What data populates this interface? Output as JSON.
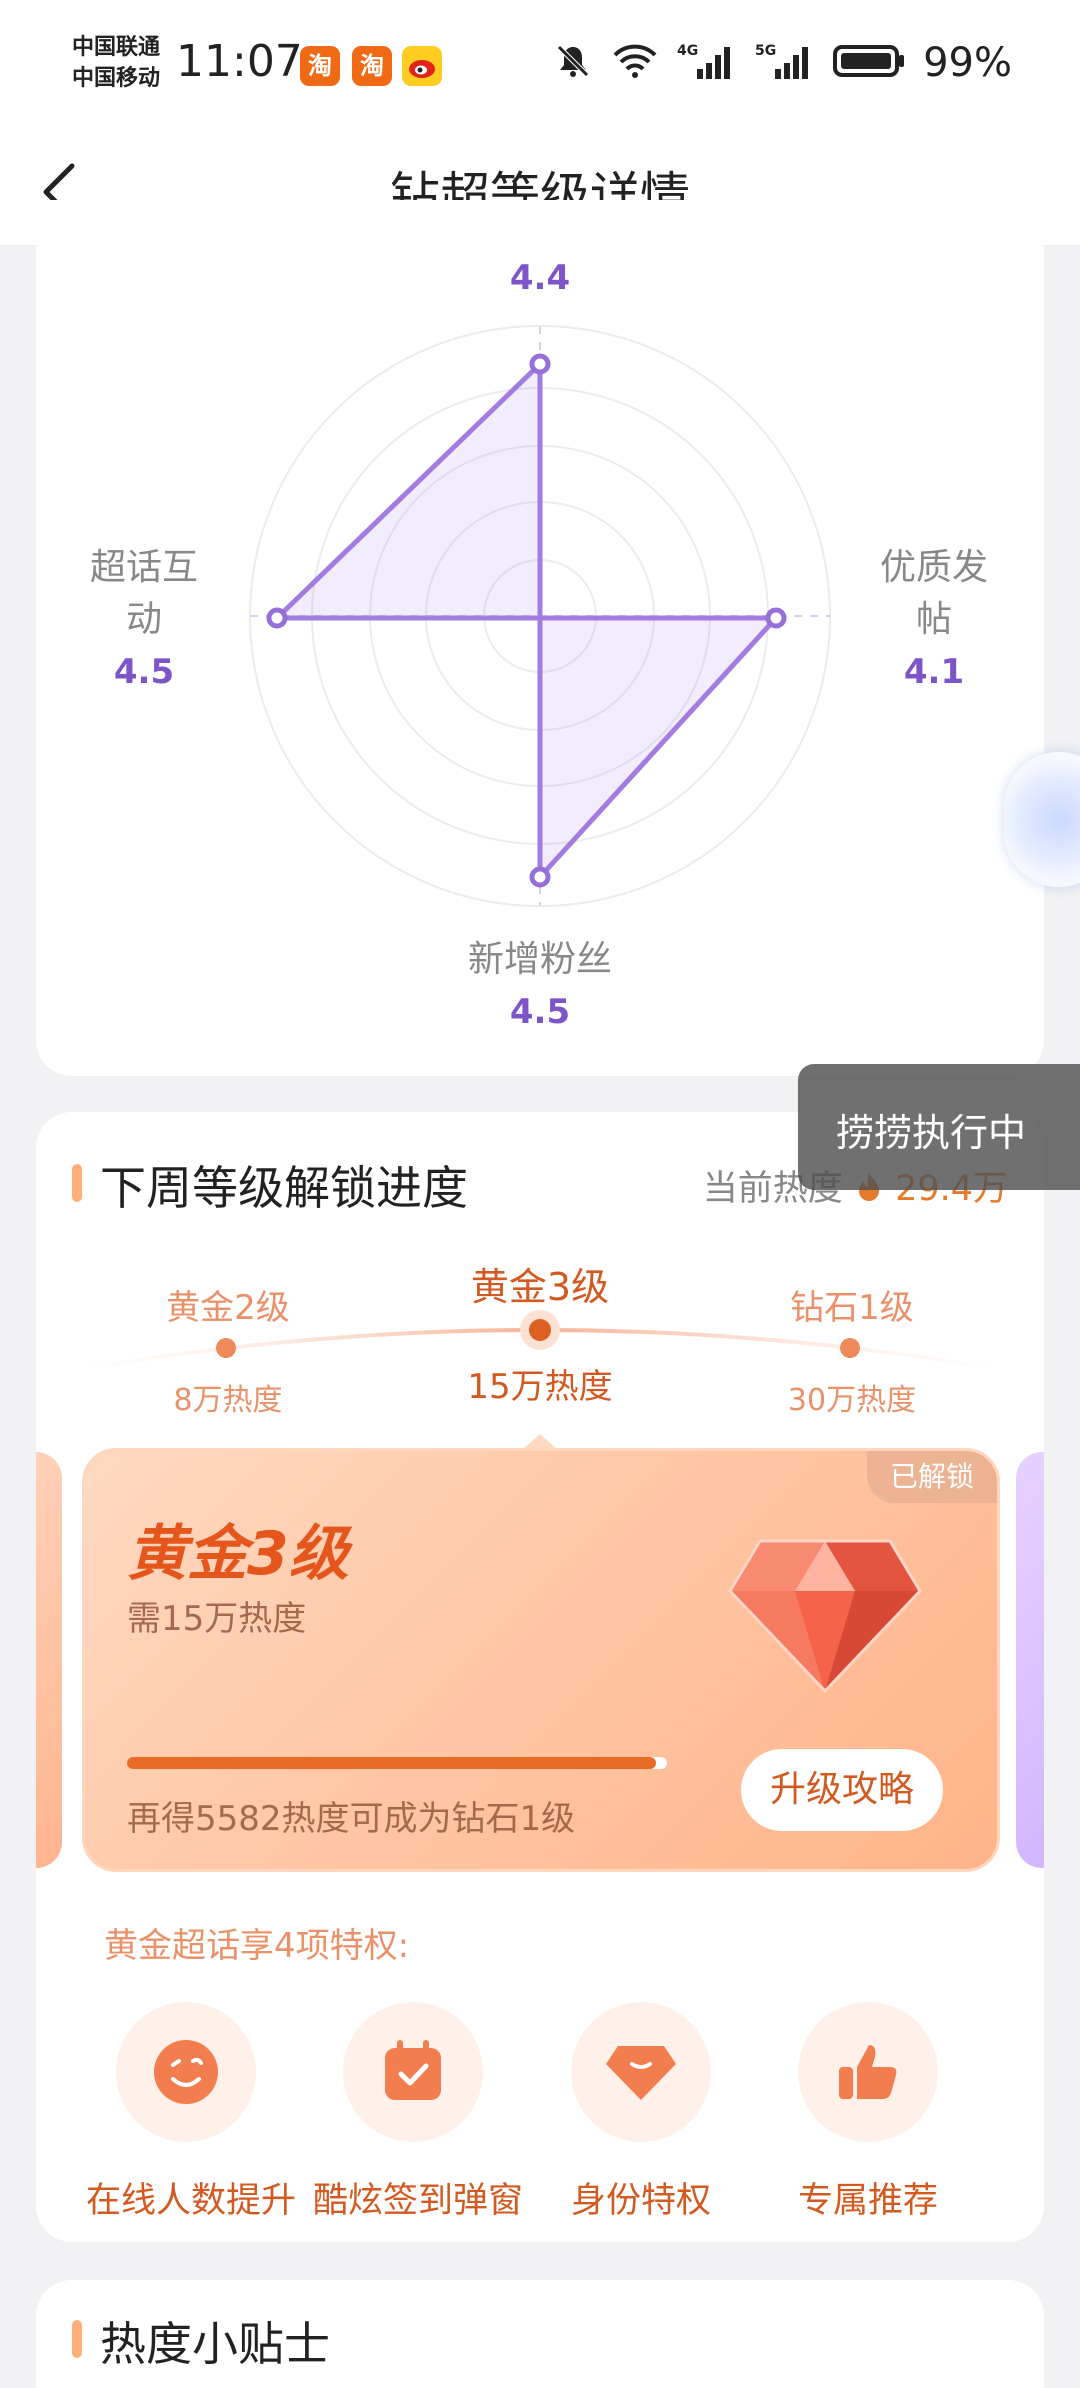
{
  "status_bar": {
    "carrier_1": "中国联通",
    "carrier_2": "中国移动",
    "time": "11:07",
    "app_badges": [
      "淘",
      "淘"
    ],
    "network_1": "4G",
    "network_2": "5G",
    "battery": "99%"
  },
  "nav": {
    "title": "钻超等级详情"
  },
  "radar": {
    "top_value": "4.4",
    "left_label": "超话互动",
    "left_value": "4.5",
    "right_label": "优质发帖",
    "right_value": "4.1",
    "bottom_label": "新增粉丝",
    "bottom_value": "4.5"
  },
  "toast": "捞捞执行中",
  "unlock": {
    "title": "下周等级解锁进度",
    "heat_label": "当前热度",
    "heat_value": "29.4万",
    "levels": [
      {
        "name": "黄金2级",
        "heat": "8万热度"
      },
      {
        "name": "黄金3级",
        "heat": "15万热度"
      },
      {
        "name": "钻石1级",
        "heat": "30万热度"
      }
    ],
    "card": {
      "tag": "已解锁",
      "title": "黄金3级",
      "requirement": "需15万热度",
      "progress_note": "再得5582热度可成为钻石1级",
      "progress": 0.98,
      "button": "升级攻略"
    },
    "perks_title": "黄金超话享4项特权:",
    "perks": [
      {
        "label": "在线人数提升",
        "icon": "smile-face-icon"
      },
      {
        "label": "酷炫签到弹窗",
        "icon": "calendar-check-icon"
      },
      {
        "label": "身份特权",
        "icon": "diamond-badge-icon"
      },
      {
        "label": "专属推荐",
        "icon": "thumbs-up-icon"
      }
    ]
  },
  "tips": {
    "title": "热度小贴士"
  },
  "colors": {
    "accent_purple": "#7e55c9",
    "accent_orange": "#e86c24"
  }
}
